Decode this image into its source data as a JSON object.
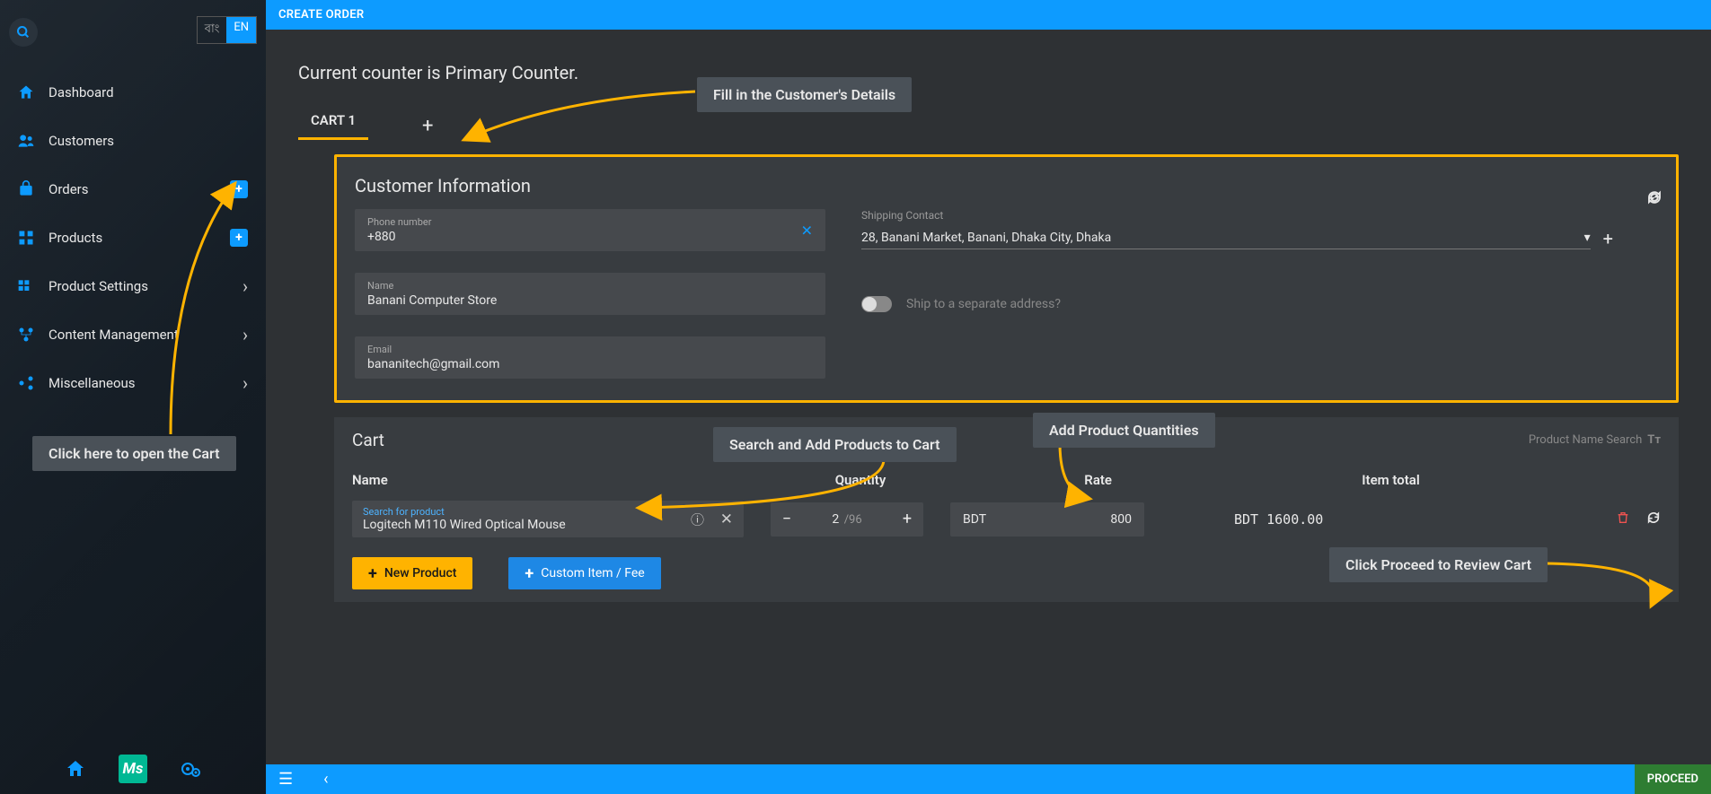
{
  "lang": {
    "bn": "বাং",
    "en": "EN"
  },
  "sidebar": {
    "items": [
      {
        "label": "Dashboard",
        "icon": "home"
      },
      {
        "label": "Customers",
        "icon": "users"
      },
      {
        "label": "Orders",
        "icon": "cart",
        "plus": true
      },
      {
        "label": "Products",
        "icon": "grid",
        "plus": true
      },
      {
        "label": "Product Settings",
        "icon": "cogs",
        "chevron": true
      },
      {
        "label": "Content Management",
        "icon": "content",
        "chevron": true
      },
      {
        "label": "Miscellaneous",
        "icon": "misc",
        "chevron": true
      }
    ]
  },
  "header": {
    "title": "CREATE ORDER"
  },
  "counter_text": "Current counter is Primary Counter.",
  "tabs": {
    "tab1": "CART 1"
  },
  "customer": {
    "section_title": "Customer Information",
    "phone_label": "Phone number",
    "phone_value": "+880",
    "name_label": "Name",
    "name_value": "Banani Computer Store",
    "email_label": "Email",
    "email_value": "bananitech@gmail.com",
    "shipping_label": "Shipping Contact",
    "shipping_value": "28, Banani Market, Banani, Dhaka City, Dhaka",
    "ship_separate": "Ship to a separate address?"
  },
  "cart": {
    "title": "Cart",
    "search_toggle": "Product Name Search",
    "col_name": "Name",
    "col_qty": "Quantity",
    "col_rate": "Rate",
    "col_total": "Item total",
    "search_label": "Search for product",
    "product_name": "Logitech M110 Wired Optical Mouse",
    "qty": "2",
    "qty_max": "/96",
    "rate_currency": "BDT",
    "rate_value": "800",
    "item_total": "BDT 1600.00",
    "btn_new": "New Product",
    "btn_custom": "Custom Item / Fee"
  },
  "footer": {
    "proceed": "PROCEED"
  },
  "annotations": {
    "a1": "Click here to open the Cart",
    "a2": "Fill in the Customer's Details",
    "a3": "Search and Add Products to Cart",
    "a4": "Add Product Quantities",
    "a5": "Click Proceed to Review Cart"
  }
}
